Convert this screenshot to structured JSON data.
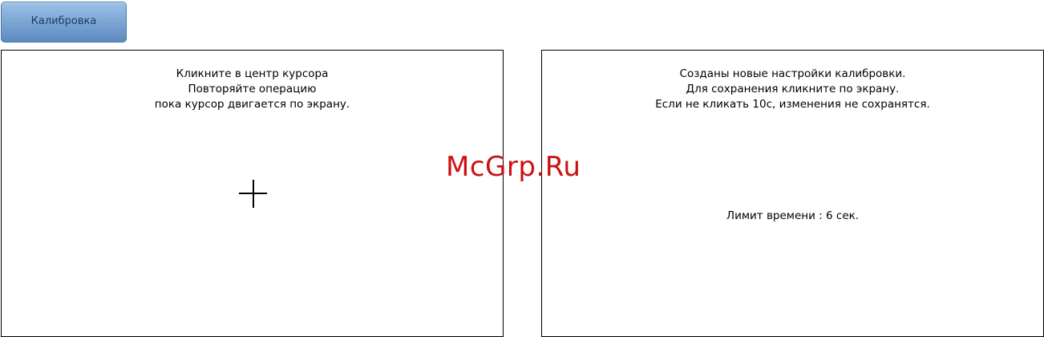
{
  "toolbar": {
    "calibrate_label": "Калибровка"
  },
  "left_panel": {
    "instruction_lines": [
      "Кликните в центр курсора",
      "Повторяйте операцию",
      "пока курсор двигается по экрану."
    ],
    "target_icon": "crosshair-icon"
  },
  "right_panel": {
    "message_lines": [
      "Созданы новые настройки калибровки.",
      "Для сохранения кликните по экрану.",
      "Если не кликать 10с, изменения не сохранятся."
    ],
    "timer_text": "Лимит времени : 6 сек."
  },
  "watermark": {
    "text": "McGrp.Ru",
    "color": "#cc1010"
  }
}
